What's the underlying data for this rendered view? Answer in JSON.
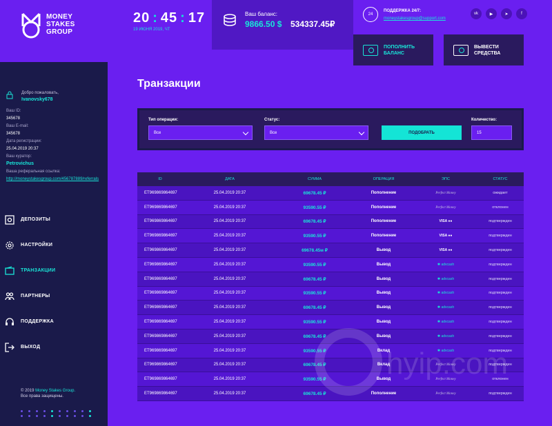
{
  "brand": {
    "logo_text": [
      "MONEY",
      "STAKES",
      "GROUP"
    ]
  },
  "clock": {
    "h": "20",
    "m": "45",
    "s": "17",
    "date": "19 ИЮНЯ 2019, ЧТ"
  },
  "balance": {
    "label": "Ваш баланс:",
    "usd": "9866.50 $",
    "rub": "534337.45₽"
  },
  "support": {
    "badge": "24",
    "label": "ПОДДЕРЖКА 24/7:",
    "email": "moneystakesgroup@support.com"
  },
  "socials": [
    "vk",
    "youtube",
    "telegram",
    "facebook"
  ],
  "actions": {
    "deposit": [
      "ПОПОЛНИТЬ",
      "БАЛАНС"
    ],
    "withdraw": [
      "ВЫВЕСТИ",
      "СРЕДСТВА"
    ]
  },
  "user": {
    "welcome": "Добро пожаловать,",
    "name": "Ivanovsky678",
    "id_label": "Ваш ID:",
    "id": "345678",
    "email_label": "Ваш E-mail:",
    "email": "345678",
    "reg_label": "Дата регистрации:",
    "reg": "25.04.2019   20:37",
    "curator_label": "Ваш куратор:",
    "curator": "Petrovichus",
    "ref_label": "Ваша реферальная ссылка:",
    "ref": "http://moneystakesgroup.com/456787889/referrals"
  },
  "nav": [
    {
      "label": "ДЕПОЗИТЫ",
      "icon": "safe-icon"
    },
    {
      "label": "НАСТРОЙКИ",
      "icon": "gear-icon"
    },
    {
      "label": "ТРАНЗАКЦИИ",
      "icon": "wallet-icon",
      "active": true
    },
    {
      "label": "ПАРТНЕРЫ",
      "icon": "users-icon"
    },
    {
      "label": "ПОДДЕРЖКА",
      "icon": "headset-icon"
    },
    {
      "label": "ВЫХОД",
      "icon": "exit-icon"
    }
  ],
  "copyright": {
    "line1_prefix": "© 2019 ",
    "brand": "Money Stakes Group.",
    "line2": "Все права защищены."
  },
  "page": {
    "title": "Транзакции"
  },
  "filters": {
    "type_label": "Тип операции:",
    "type_value": "Все",
    "status_label": "Статус:",
    "status_value": "Все",
    "button": "ПОДОБРАТЬ",
    "qty_label": "Количество:",
    "qty_value": "15"
  },
  "table": {
    "headers": [
      "ID",
      "ДАТА",
      "СУММА",
      "ОПЕРАЦИЯ",
      "ЭПС",
      "СТАТУС"
    ],
    "rows": [
      {
        "id": "ET969869864697",
        "date": "25.04.2019   20:37",
        "sum": "69678.45 ₽",
        "op": "Пополнение",
        "eps": "pm",
        "status": "ожидает"
      },
      {
        "id": "ET969869864697",
        "date": "25.04.2019   20:37",
        "sum": "93590.55 ₽",
        "op": "Пополнение",
        "eps": "pm",
        "status": "отклонен"
      },
      {
        "id": "ET969869864697",
        "date": "25.04.2019   20:37",
        "sum": "69678.45 ₽",
        "op": "Пополнение",
        "eps": "visa",
        "status": "подтвержден"
      },
      {
        "id": "ET969869864697",
        "date": "25.04.2019   20:37",
        "sum": "93590.55 ₽",
        "op": "Пополнение",
        "eps": "visa",
        "status": "подтвержден"
      },
      {
        "id": "ET969869864697",
        "date": "25.04.2019   20:37",
        "sum": "69678.45м ₽",
        "op": "Вывод",
        "eps": "visa",
        "status": "подтвержден"
      },
      {
        "id": "ET969869864697",
        "date": "25.04.2019   20:37",
        "sum": "93590.55 ₽",
        "op": "Вывод",
        "eps": "adv",
        "status": "подтвержден"
      },
      {
        "id": "ET969869864697",
        "date": "25.04.2019   20:37",
        "sum": "69678.45 ₽",
        "op": "Вывод",
        "eps": "adv",
        "status": "подтвержден"
      },
      {
        "id": "ET969869864697",
        "date": "25.04.2019   20:37",
        "sum": "93590.55 ₽",
        "op": "Вывод",
        "eps": "adv",
        "status": "подтвержден"
      },
      {
        "id": "ET969869864697",
        "date": "25.04.2019   20:37",
        "sum": "69678.45 ₽",
        "op": "Вывод",
        "eps": "adv",
        "status": "подтвержден"
      },
      {
        "id": "ET969869864697",
        "date": "25.04.2019   20:37",
        "sum": "93590.55 ₽",
        "op": "Вывод",
        "eps": "adv",
        "status": "подтвержден"
      },
      {
        "id": "ET969869864697",
        "date": "25.04.2019   20:37",
        "sum": "69678.45 ₽",
        "op": "Вывод",
        "eps": "adv",
        "status": "подтвержден"
      },
      {
        "id": "ET969869864697",
        "date": "25.04.2019   20:37",
        "sum": "93590.55 ₽",
        "op": "Вклад",
        "eps": "adv",
        "status": "подтвержден"
      },
      {
        "id": "ET969869864697",
        "date": "25.04.2019   20:37",
        "sum": "69678.45 ₽",
        "op": "Вклад",
        "eps": "pm",
        "status": "подтвержден"
      },
      {
        "id": "ET969869864697",
        "date": "25.04.2019   20:37",
        "sum": "93590.55 ₽",
        "op": "Вывод",
        "eps": "pm",
        "status": "отклонен"
      },
      {
        "id": "ET969869864697",
        "date": "25.04.2019   20:37",
        "sum": "69678.45 ₽",
        "op": "Пополнение",
        "eps": "pm",
        "status": "подтвержден"
      }
    ]
  },
  "eps_labels": {
    "pm": "Perfect Money",
    "visa": "VISA ●●",
    "adv": "advcash"
  },
  "watermark": "hyip.com",
  "colors": {
    "bg": "#6a1ff0",
    "sidebar": "#1a1a4a",
    "accent": "#19e6d8",
    "panel": "#2a1a5e"
  }
}
